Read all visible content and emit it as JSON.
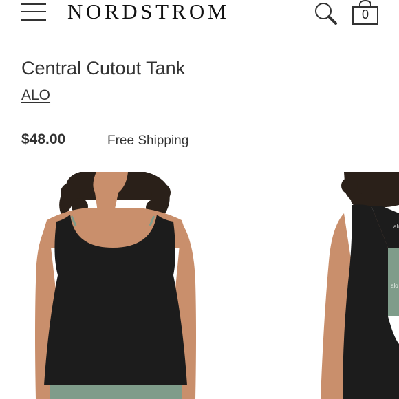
{
  "header": {
    "logo": "NORDSTROM",
    "bag_count": "0",
    "icons": [
      "hamburger-menu-icon",
      "search-icon",
      "shopping-bag-icon"
    ]
  },
  "product": {
    "title": "Central Cutout Tank",
    "brand": "ALO",
    "price": "$48.00",
    "shipping": "Free Shipping"
  },
  "colors": {
    "text": "#333333",
    "tank": "#1c1c1c",
    "leggings": "#7f9c8a",
    "skin": "#c98f6c",
    "hair": "#2a2019"
  }
}
